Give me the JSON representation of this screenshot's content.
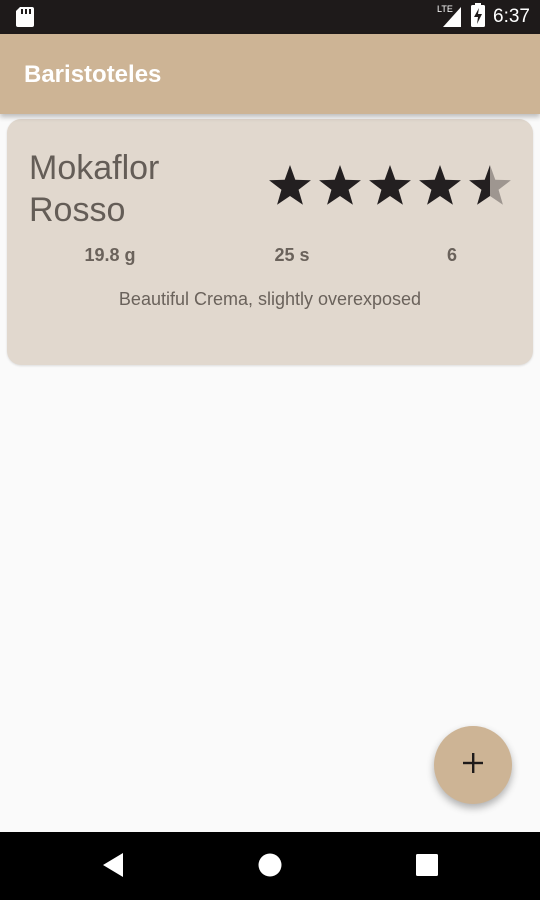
{
  "status_bar": {
    "time": "6:37",
    "network": "LTE",
    "icons": [
      "sd-card-icon",
      "signal-icon",
      "battery-charging-icon"
    ]
  },
  "app_bar": {
    "title": "Baristoteles"
  },
  "entries": [
    {
      "name": "Mokaflor Rosso",
      "rating": 4.5,
      "rating_max": 5,
      "dose": "19.8 g",
      "time": "25 s",
      "grind": "6",
      "note": "Beautiful Crema, slightly overexposed"
    }
  ],
  "fab": {
    "icon": "plus-icon"
  },
  "nav_bar": {
    "icons": [
      "back-icon",
      "home-icon",
      "recents-icon"
    ]
  },
  "colors": {
    "primary": "#cdb495",
    "card": "#e1d8ce",
    "star_filled": "#231f20",
    "star_empty": "#9e9690"
  }
}
